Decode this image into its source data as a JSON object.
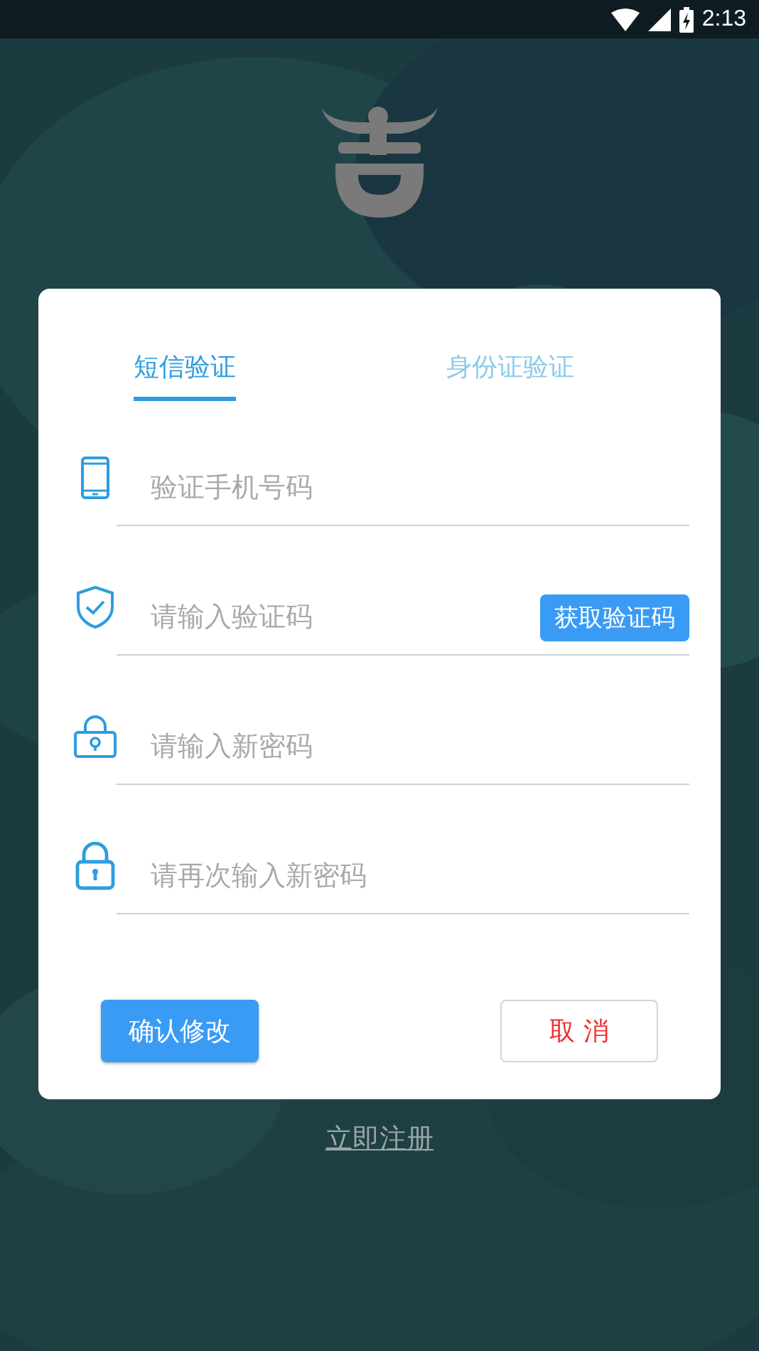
{
  "status_bar": {
    "time": "2:13"
  },
  "dialog": {
    "tabs": [
      {
        "label": "短信验证",
        "selected": true
      },
      {
        "label": "身份证验证",
        "selected": false
      }
    ],
    "fields": [
      {
        "kind": "phone",
        "placeholder": "验证手机号码"
      },
      {
        "kind": "code",
        "placeholder": "请输入验证码",
        "button": "获取验证码"
      },
      {
        "kind": "password",
        "placeholder": "请输入新密码"
      },
      {
        "kind": "password_repeat",
        "placeholder": "请再次输入新密码"
      }
    ],
    "confirm_button": "确认修改",
    "cancel_button": "取 消"
  },
  "register_link": "立即注册"
}
